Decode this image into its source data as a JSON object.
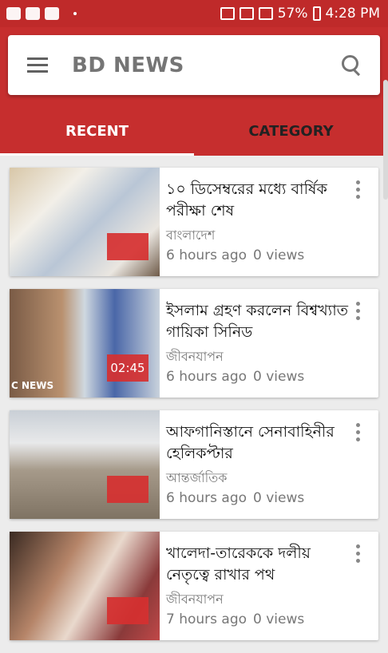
{
  "status_bar": {
    "battery": "57%",
    "time": "4:28 PM"
  },
  "app_bar": {
    "title": "BD NEWS"
  },
  "tabs": [
    {
      "label": "RECENT",
      "active": true
    },
    {
      "label": "CATEGORY",
      "active": false
    }
  ],
  "news": [
    {
      "title": "১০ ডিসেম্বরের মধ্যে বার্ষিক পরীক্ষা শেষ",
      "category": "বাংলাদেশ",
      "time": "6 hours ago",
      "views": "0 views",
      "duration": ""
    },
    {
      "title": "ইসলাম গ্রহণ করলেন বিশ্বখ্যাত গায়িকা সিনিড",
      "category": "জীবনযাপন",
      "time": "6 hours ago",
      "views": "0 views",
      "duration": "02:45",
      "thumb_label": "C NEWS"
    },
    {
      "title": "আফগানিস্তানে সেনাবাহিনীর হেলিকপ্টার",
      "category": "আন্তর্জাতিক",
      "time": "6 hours ago",
      "views": "0 views",
      "duration": ""
    },
    {
      "title": "খালেদা-তারেককে দলীয় নেতৃত্বে রাখার পথ",
      "category": "জীবনযাপন",
      "time": "7 hours ago",
      "views": "0 views",
      "duration": ""
    }
  ],
  "colors": {
    "primary": "#c62e2e",
    "status_bar": "#bf2a2a",
    "duration_badge": "#d63030"
  }
}
